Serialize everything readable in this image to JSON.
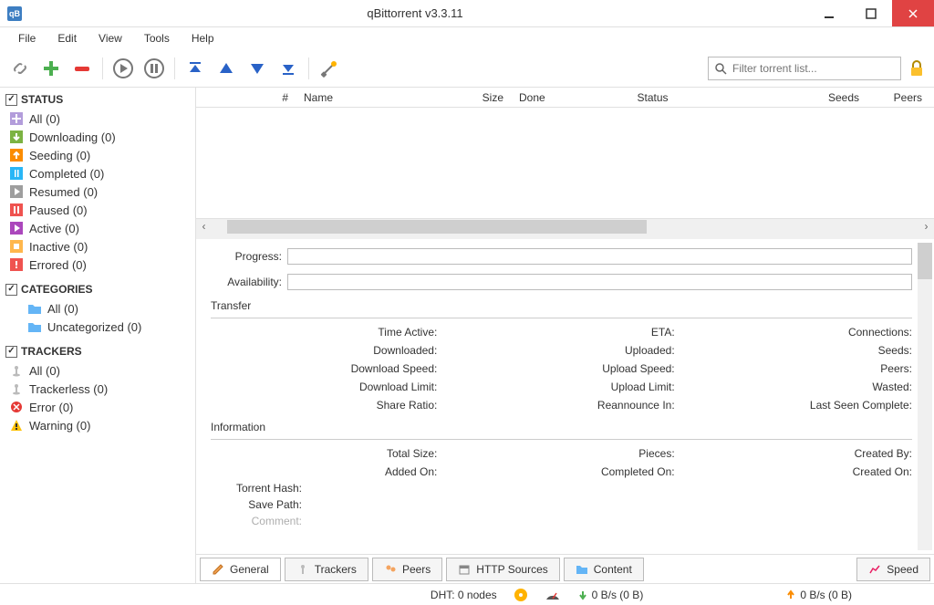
{
  "window": {
    "title": "qBittorrent v3.3.11"
  },
  "menu": {
    "file": "File",
    "edit": "Edit",
    "view": "View",
    "tools": "Tools",
    "help": "Help"
  },
  "search": {
    "placeholder": "Filter torrent list..."
  },
  "sidebar": {
    "statusHeader": "STATUS",
    "status": [
      {
        "label": "All (0)"
      },
      {
        "label": "Downloading (0)"
      },
      {
        "label": "Seeding (0)"
      },
      {
        "label": "Completed (0)"
      },
      {
        "label": "Resumed (0)"
      },
      {
        "label": "Paused (0)"
      },
      {
        "label": "Active (0)"
      },
      {
        "label": "Inactive (0)"
      },
      {
        "label": "Errored (0)"
      }
    ],
    "categoriesHeader": "CATEGORIES",
    "categories": [
      {
        "label": "All  (0)"
      },
      {
        "label": "Uncategorized  (0)"
      }
    ],
    "trackersHeader": "TRACKERS",
    "trackers": [
      {
        "label": "All (0)"
      },
      {
        "label": "Trackerless (0)"
      },
      {
        "label": "Error (0)"
      },
      {
        "label": "Warning (0)"
      }
    ]
  },
  "columns": {
    "num": "#",
    "name": "Name",
    "size": "Size",
    "done": "Done",
    "status": "Status",
    "seeds": "Seeds",
    "peers": "Peers"
  },
  "details": {
    "progress": "Progress:",
    "availability": "Availability:",
    "transferTitle": "Transfer",
    "transfer": {
      "timeActive": "Time Active:",
      "eta": "ETA:",
      "connections": "Connections:",
      "downloaded": "Downloaded:",
      "uploaded": "Uploaded:",
      "seeds": "Seeds:",
      "dlSpeed": "Download Speed:",
      "ulSpeed": "Upload Speed:",
      "peers": "Peers:",
      "dlLimit": "Download Limit:",
      "ulLimit": "Upload Limit:",
      "wasted": "Wasted:",
      "shareRatio": "Share Ratio:",
      "reannounce": "Reannounce In:",
      "lastSeen": "Last Seen Complete:"
    },
    "infoTitle": "Information",
    "info": {
      "totalSize": "Total Size:",
      "pieces": "Pieces:",
      "createdBy": "Created By:",
      "addedOn": "Added On:",
      "completedOn": "Completed On:",
      "createdOn": "Created On:",
      "torrentHash": "Torrent Hash:",
      "savePath": "Save Path:",
      "comment": "Comment:"
    }
  },
  "tabs": {
    "general": "General",
    "trackers": "Trackers",
    "peers": "Peers",
    "http": "HTTP Sources",
    "content": "Content",
    "speed": "Speed"
  },
  "status": {
    "dht": "DHT: 0 nodes",
    "down": "0 B/s (0 B)",
    "up": "0 B/s (0 B)"
  }
}
